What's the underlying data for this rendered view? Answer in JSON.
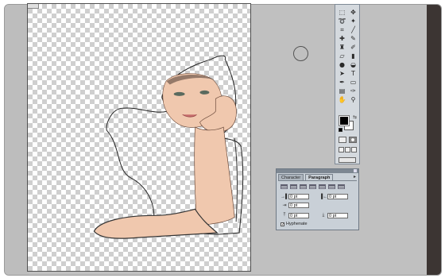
{
  "toolbox": {
    "tools": [
      {
        "icon": "marquee-icon",
        "glyph": "⬚"
      },
      {
        "icon": "move-icon",
        "glyph": "✥"
      },
      {
        "icon": "lasso-icon",
        "glyph": "➰"
      },
      {
        "icon": "magic-wand-icon",
        "glyph": "✦"
      },
      {
        "icon": "crop-icon",
        "glyph": "⌗"
      },
      {
        "icon": "slice-icon",
        "glyph": "╱"
      },
      {
        "icon": "healing-brush-icon",
        "glyph": "✚"
      },
      {
        "icon": "brush-icon",
        "glyph": "✎"
      },
      {
        "icon": "clone-stamp-icon",
        "glyph": "♜"
      },
      {
        "icon": "history-brush-icon",
        "glyph": "✐"
      },
      {
        "icon": "eraser-icon",
        "glyph": "▱"
      },
      {
        "icon": "gradient-icon",
        "glyph": "▮"
      },
      {
        "icon": "blur-icon",
        "glyph": "●"
      },
      {
        "icon": "dodge-icon",
        "glyph": "◒"
      },
      {
        "icon": "path-selection-icon",
        "glyph": "➤"
      },
      {
        "icon": "type-icon",
        "glyph": "T"
      },
      {
        "icon": "pen-icon",
        "glyph": "✒"
      },
      {
        "icon": "shape-icon",
        "glyph": "▭"
      },
      {
        "icon": "notes-icon",
        "glyph": "▤"
      },
      {
        "icon": "eyedropper-icon",
        "glyph": "✑"
      },
      {
        "icon": "hand-icon",
        "glyph": "✋"
      },
      {
        "icon": "zoom-icon",
        "glyph": "⚲"
      }
    ],
    "foreground_color": "#000000",
    "background_color": "#ffffff"
  },
  "panel": {
    "tabs": [
      {
        "label": "Character",
        "active": false
      },
      {
        "label": "Paragraph",
        "active": true
      }
    ],
    "menu_glyph": "▸",
    "fields": {
      "indent_left": "0 pt",
      "indent_right": "0 pt",
      "indent_first": "0 pt",
      "space_before": "0 pt",
      "space_after": "0 pt"
    },
    "field_icons": {
      "indent_left": "→▌",
      "indent_right": "▐←",
      "indent_first": "⇥",
      "space_before": "⤒",
      "space_after": "⤓"
    },
    "hyphenate_label": "Hyphenate",
    "hyphenate_mark": "✓"
  },
  "colors": {
    "workspace": "#c0c0c0",
    "panel": "#c9d0d7",
    "right_strip": "#3c3533"
  }
}
